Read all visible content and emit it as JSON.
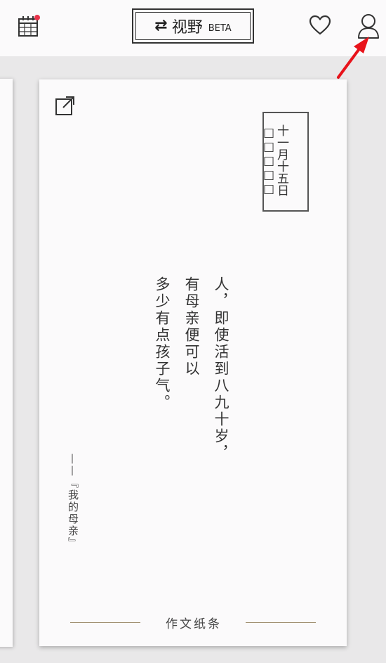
{
  "header": {
    "title": "视野",
    "badge": "BETA",
    "switch_icon": "⇄",
    "notification_dot_color": "#e8334a",
    "icons": [
      "calendar-icon",
      "heart-icon",
      "user-icon"
    ]
  },
  "card": {
    "date": "十一月十五日",
    "date_placeholders": "□□□□□",
    "poem_lines": [
      "人，即使活到八九十岁，",
      "有母亲便可以",
      "多少有点孩子气。"
    ],
    "source": "——『我的母亲』",
    "footer": "作文纸条",
    "accent_color": "#a08f70"
  },
  "annotation": {
    "arrow_color": "#e8131b"
  }
}
